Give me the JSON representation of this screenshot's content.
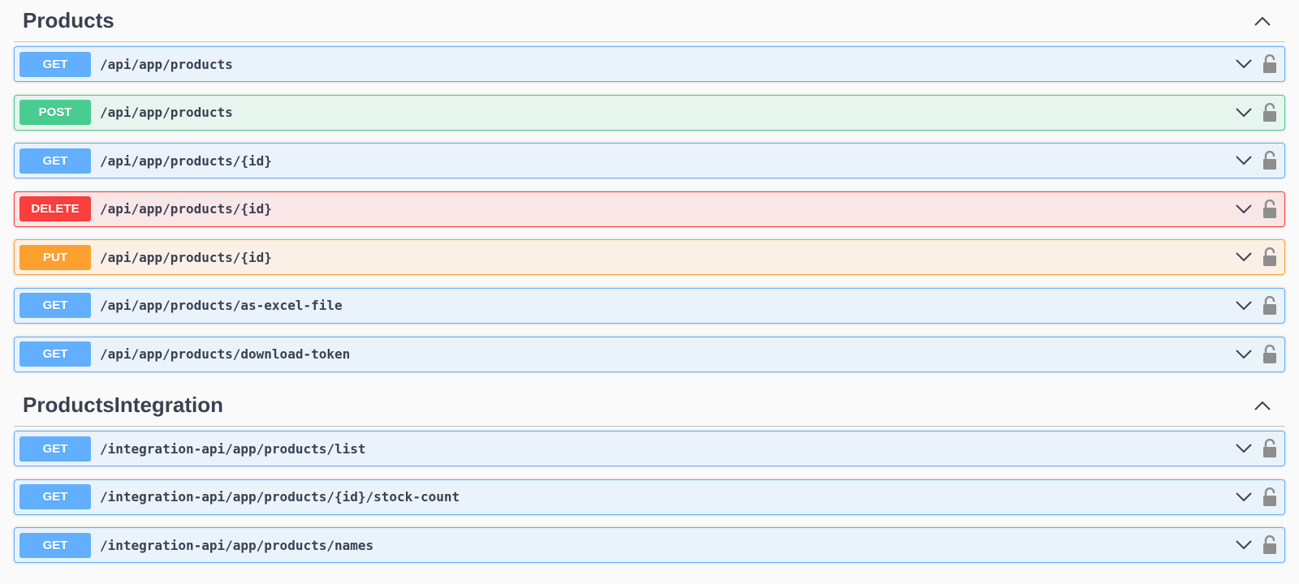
{
  "sections": [
    {
      "title": "Products",
      "operations": [
        {
          "method": "GET",
          "path": "/api/app/products",
          "kind": "get"
        },
        {
          "method": "POST",
          "path": "/api/app/products",
          "kind": "post"
        },
        {
          "method": "GET",
          "path": "/api/app/products/{id}",
          "kind": "get"
        },
        {
          "method": "DELETE",
          "path": "/api/app/products/{id}",
          "kind": "delete"
        },
        {
          "method": "PUT",
          "path": "/api/app/products/{id}",
          "kind": "put"
        },
        {
          "method": "GET",
          "path": "/api/app/products/as-excel-file",
          "kind": "get"
        },
        {
          "method": "GET",
          "path": "/api/app/products/download-token",
          "kind": "get"
        }
      ]
    },
    {
      "title": "ProductsIntegration",
      "operations": [
        {
          "method": "GET",
          "path": "/integration-api/app/products/list",
          "kind": "get"
        },
        {
          "method": "GET",
          "path": "/integration-api/app/products/{id}/stock-count",
          "kind": "get"
        },
        {
          "method": "GET",
          "path": "/integration-api/app/products/names",
          "kind": "get"
        }
      ]
    }
  ],
  "icons": {
    "section_toggle": "chevron-up-icon",
    "expand": "chevron-down-icon",
    "auth": "lock-icon"
  },
  "colors": {
    "get": "#61affe",
    "post": "#49cc90",
    "delete": "#f93e3e",
    "put": "#fca130",
    "text": "#3b4151"
  }
}
